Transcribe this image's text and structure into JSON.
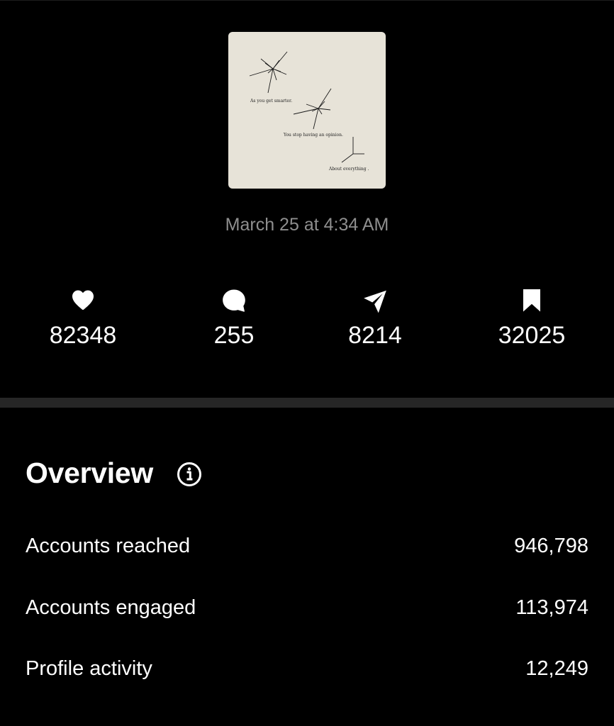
{
  "post": {
    "thumbnail": {
      "background": "#e7e3d8",
      "lines": [
        "As you get smarter.",
        "You stop having an opinion.",
        "About everything ."
      ]
    },
    "timestamp": "March 25 at 4:34 AM"
  },
  "stats": {
    "likes": "82348",
    "comments": "255",
    "shares": "8214",
    "saves": "32025"
  },
  "overview": {
    "title": "Overview",
    "rows": [
      {
        "label": "Accounts reached",
        "value": "946,798"
      },
      {
        "label": "Accounts engaged",
        "value": "113,974"
      },
      {
        "label": "Profile activity",
        "value": "12,249"
      }
    ]
  },
  "colors": {
    "background": "#000000",
    "text": "#ffffff",
    "muted": "#8e8e8e",
    "divider": "#262626"
  }
}
